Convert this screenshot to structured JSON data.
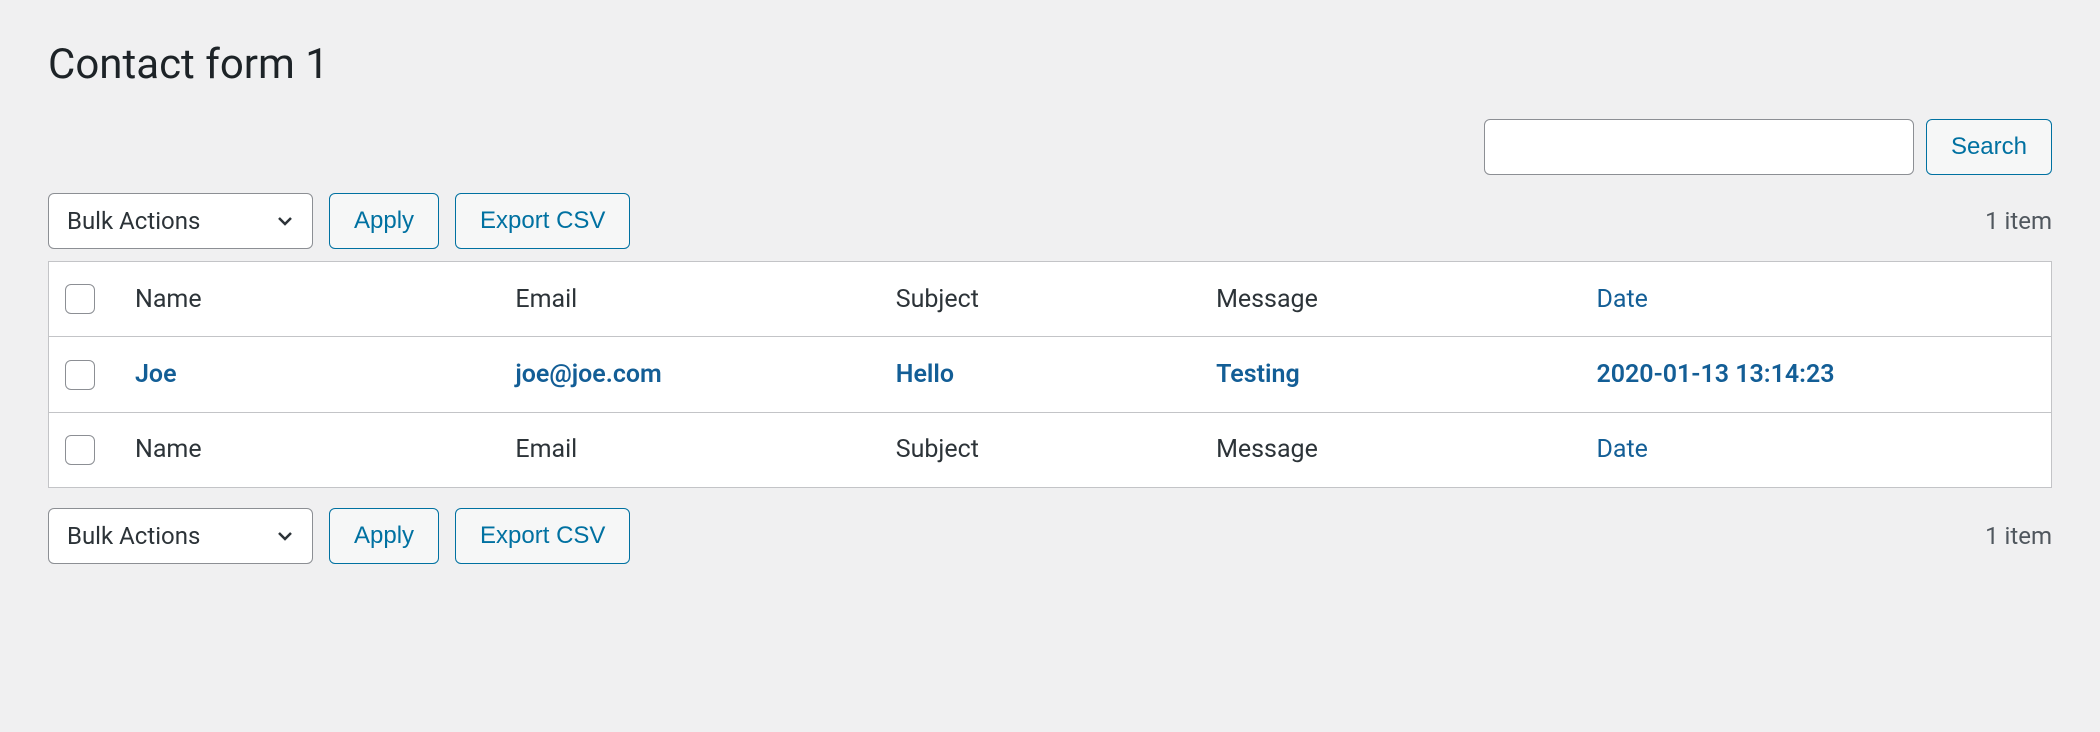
{
  "page_title": "Contact form 1",
  "search": {
    "placeholder": "",
    "button_label": "Search"
  },
  "bulk_actions": {
    "selected_label": "Bulk Actions"
  },
  "buttons": {
    "apply": "Apply",
    "export_csv": "Export CSV"
  },
  "item_count": "1 item",
  "columns": {
    "name": "Name",
    "email": "Email",
    "subject": "Subject",
    "message": "Message",
    "date": "Date"
  },
  "rows": [
    {
      "name": "Joe",
      "email": "joe@joe.com",
      "subject": "Hello",
      "message": "Testing",
      "date": "2020-01-13 13:14:23"
    }
  ]
}
